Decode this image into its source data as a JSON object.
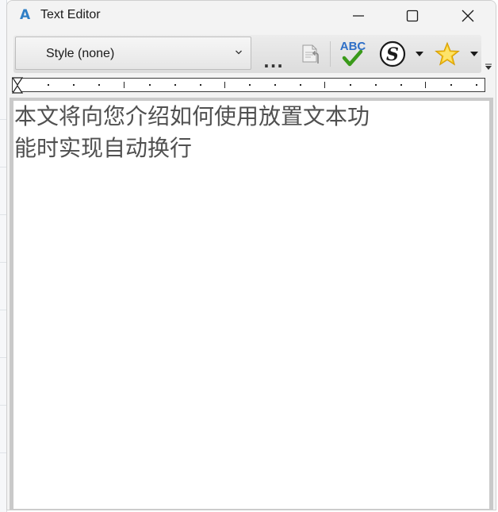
{
  "window": {
    "app_icon_glyph": "A",
    "title": "Text Editor"
  },
  "toolbar": {
    "style_value": "Style (none)",
    "more_label": "...",
    "buttons": [
      "paste-special-icon",
      "spellcheck-icon",
      "signature-icon",
      "favorites-star-icon"
    ]
  },
  "document": {
    "line1": "本文将向您介绍如何使用放置文本功",
    "line2": "能时实现自动换行"
  },
  "colors": {
    "accent": "#2f7fc6",
    "spellcheck_text": "#2e6fc7",
    "spellcheck_check": "#3a9a1a",
    "star": "#f5c21b",
    "text": "#505050"
  }
}
